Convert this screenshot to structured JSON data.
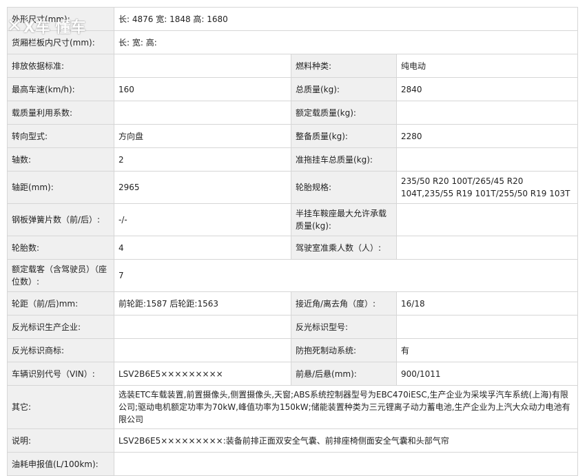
{
  "watermark": {
    "text": "X车 懂车"
  },
  "rows": [
    {
      "l1": "外形尺寸(mm):",
      "v1": "长: 4876 宽: 1848 高: 1680"
    },
    {
      "l1": "货厢栏板内尺寸(mm):",
      "v1": "长:  宽:  高:"
    },
    {
      "l1": "排放依据标准:",
      "v1": "",
      "l2": "燃料种类:",
      "v2": "纯电动"
    },
    {
      "l1": "最高车速(km/h):",
      "v1": "160",
      "l2": "总质量(kg):",
      "v2": "2840"
    },
    {
      "l1": "载质量利用系数:",
      "v1": "",
      "l2": "额定载质量(kg):",
      "v2": ""
    },
    {
      "l1": "转向型式:",
      "v1": "方向盘",
      "l2": "整备质量(kg):",
      "v2": "2280"
    },
    {
      "l1": "轴数:",
      "v1": "2",
      "l2": "准拖挂车总质量(kg):",
      "v2": ""
    },
    {
      "l1": "轴距(mm):",
      "v1": "2965",
      "l2": "轮胎规格:",
      "v2": "235/50 R20 100T/265/45 R20 104T,235/55 R19 101T/255/50 R19 103T"
    },
    {
      "l1": "钢板弹簧片数（前/后）:",
      "v1": "-/-",
      "l2": "半挂车鞍座最大允许承载质量(kg):",
      "v2": ""
    },
    {
      "l1": "轮胎数:",
      "v1": "4",
      "l2": "驾驶室准乘人数（人）:",
      "v2": ""
    },
    {
      "l1": "额定载客（含驾驶员）（座位数）:",
      "v1": "7"
    },
    {
      "l1": "轮距（前/后)mm:",
      "v1": "前轮距:1587 后轮距:1563",
      "l2": "接近角/离去角（度）:",
      "v2": "16/18"
    },
    {
      "l1": "反光标识生产企业:",
      "v1": "",
      "l2": "反光标识型号:",
      "v2": ""
    },
    {
      "l1": "反光标识商标:",
      "v1": "",
      "l2": "防抱死制动系统:",
      "v2": "有"
    },
    {
      "l1": "车辆识别代号（VIN）:",
      "v1": "LSV2B6E5×××××××××",
      "l2": "前悬/后悬(mm):",
      "v2": "900/1011"
    },
    {
      "l1": "其它:",
      "v1": "选装ETC车载装置,前置摄像头,侧置摄像头,天窗;ABS系统控制器型号为EBC470iESC,生产企业为采埃孚汽车系统(上海)有限公司;驱动电机额定功率为70kW,峰值功率为150kW;储能装置种类为三元锂离子动力蓄电池,生产企业为上汽大众动力电池有限公司"
    },
    {
      "l1": "说明:",
      "v1": "LSV2B6E5×××××××××:装备前排正面双安全气囊、前排座椅侧面安全气囊和头部气帘"
    },
    {
      "l1": "油耗申报值(L/100km):",
      "v1": ""
    }
  ]
}
